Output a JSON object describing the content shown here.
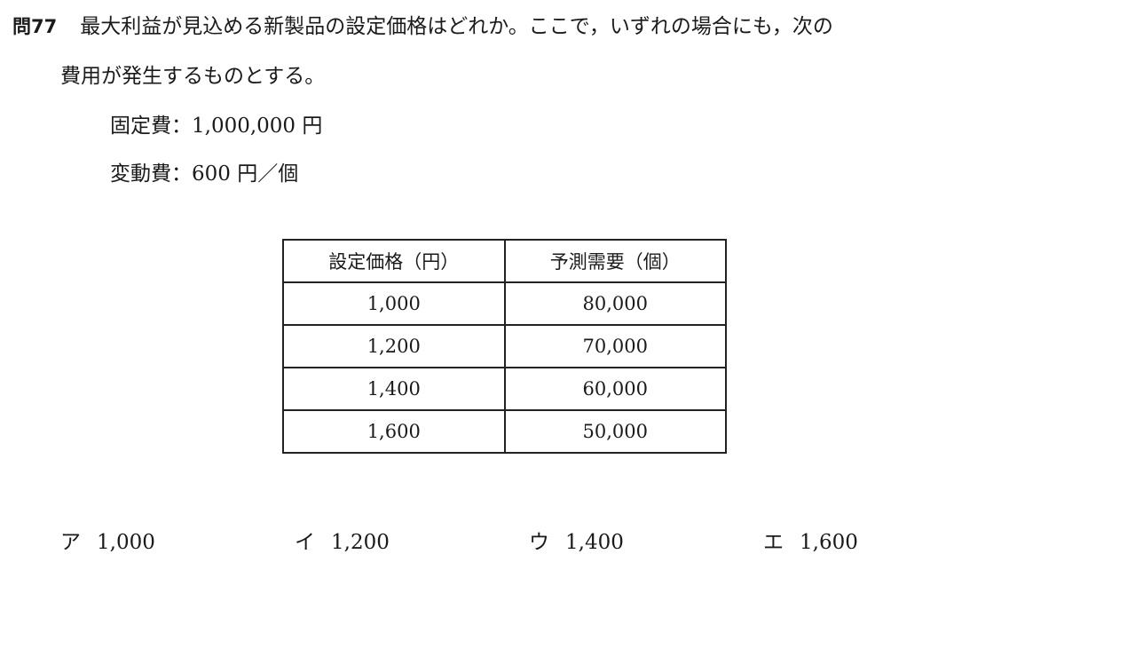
{
  "question": {
    "number": "問77",
    "text_line1": "最大利益が見込める新製品の設定価格はどれか。ここで，いずれの場合にも，次の",
    "text_line2": "費用が発生するものとする。"
  },
  "costs": {
    "fixed": "固定費：1,000,000 円",
    "variable": "変動費：600 円／個"
  },
  "table": {
    "headers": [
      "設定価格（円）",
      "予測需要（個）"
    ],
    "rows": [
      [
        "1,000",
        "80,000"
      ],
      [
        "1,200",
        "70,000"
      ],
      [
        "1,400",
        "60,000"
      ],
      [
        "1,600",
        "50,000"
      ]
    ]
  },
  "choices": [
    {
      "letter": "ア",
      "value": "1,000"
    },
    {
      "letter": "イ",
      "value": "1,200"
    },
    {
      "letter": "ウ",
      "value": "1,400"
    },
    {
      "letter": "エ",
      "value": "1,600"
    }
  ]
}
